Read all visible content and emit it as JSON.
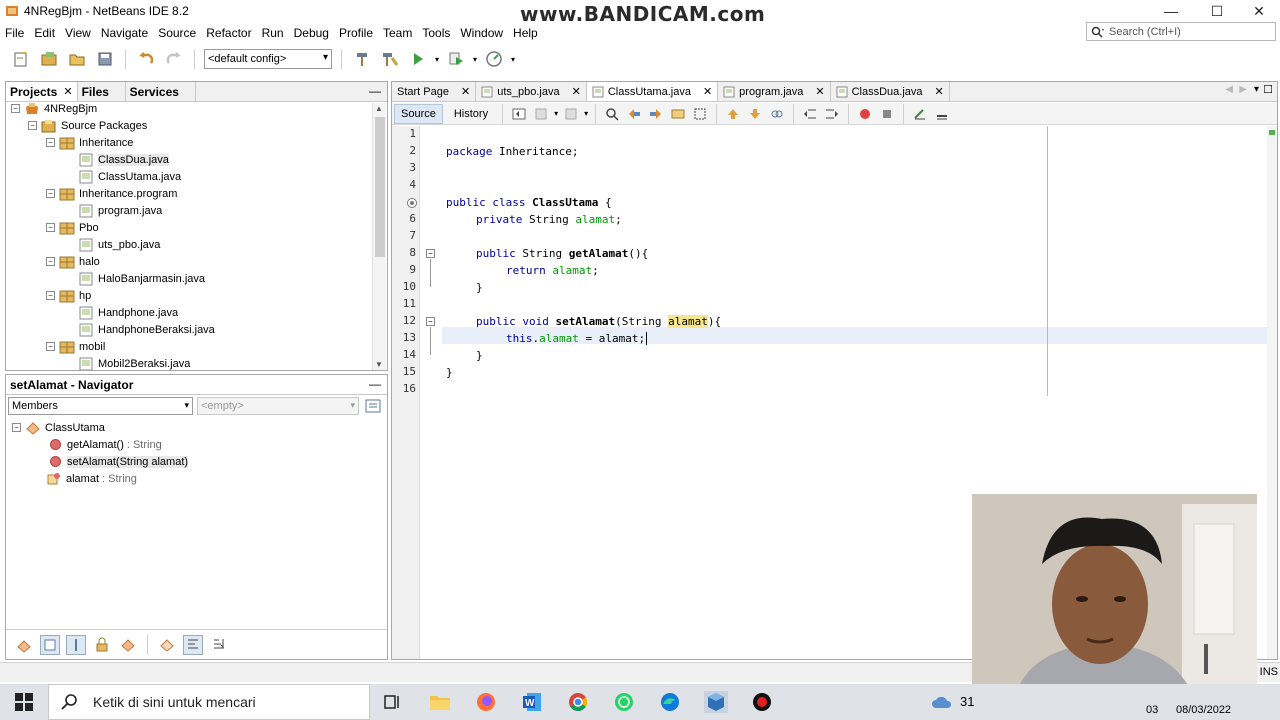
{
  "window": {
    "title": "4NRegBjm - NetBeans IDE 8.2",
    "watermark": "www.BANDICAM.com",
    "minimize": "—",
    "maximize": "☐",
    "close": "✕"
  },
  "menubar": [
    "File",
    "Edit",
    "View",
    "Navigate",
    "Source",
    "Refactor",
    "Run",
    "Debug",
    "Profile",
    "Team",
    "Tools",
    "Window",
    "Help"
  ],
  "search": {
    "placeholder": "Search (Ctrl+I)"
  },
  "toolbar": {
    "config": "<default config>"
  },
  "projects_panel": {
    "tabs": [
      {
        "label": "Projects",
        "close": "✕"
      },
      {
        "label": "Files"
      },
      {
        "label": "Services"
      }
    ],
    "minimize": "—",
    "tree": [
      {
        "label": "4NRegBjm",
        "toggle": "−",
        "icon": "project-icon"
      },
      {
        "label": "Source Packages",
        "toggle": "−",
        "icon": "source-packages-icon"
      },
      {
        "label": "Inheritance",
        "toggle": "−",
        "icon": "package-icon"
      },
      {
        "label": "ClassDua.java",
        "icon": "java-file-icon",
        "selected": true
      },
      {
        "label": "ClassUtama.java",
        "icon": "java-file-icon"
      },
      {
        "label": "Inheritance.program",
        "toggle": "−",
        "icon": "package-icon"
      },
      {
        "label": "program.java",
        "icon": "java-file-icon"
      },
      {
        "label": "Pbo",
        "toggle": "−",
        "icon": "package-icon"
      },
      {
        "label": "uts_pbo.java",
        "icon": "java-file-icon"
      },
      {
        "label": "halo",
        "toggle": "−",
        "icon": "package-icon"
      },
      {
        "label": "HaloBanjarmasin.java",
        "icon": "java-file-icon"
      },
      {
        "label": "hp",
        "toggle": "−",
        "icon": "package-icon"
      },
      {
        "label": "Handphone.java",
        "icon": "java-file-icon"
      },
      {
        "label": "HandphoneBeraksi.java",
        "icon": "java-file-icon"
      },
      {
        "label": "mobil",
        "toggle": "−",
        "icon": "package-icon"
      },
      {
        "label": "Mobil2Beraksi.java",
        "icon": "java-file-icon"
      }
    ]
  },
  "navigator": {
    "title": "setAlamat - Navigator",
    "minimize": "—",
    "filter_members": "Members",
    "filter_empty": "<empty>",
    "class_name": "ClassUtama",
    "members": [
      {
        "name": "getAlamat()",
        "type": ": String"
      },
      {
        "name": "setAlamat(String alamat)",
        "type": ""
      },
      {
        "name": "alamat",
        "type": ": String"
      }
    ]
  },
  "editor": {
    "tabs": [
      {
        "label": "Start Page",
        "close": "✕"
      },
      {
        "label": "uts_pbo.java",
        "close": "✕"
      },
      {
        "label": "ClassUtama.java",
        "close": "✕",
        "active": true
      },
      {
        "label": "program.java",
        "close": "✕"
      },
      {
        "label": "ClassDua.java",
        "close": "✕"
      }
    ],
    "source_label": "Source",
    "history_label": "History",
    "line_numbers": [
      "1",
      "2",
      "3",
      "4",
      "5",
      "6",
      "7",
      "8",
      "9",
      "10",
      "11",
      "12",
      "13",
      "14",
      "15",
      "16"
    ],
    "current_line": 13,
    "code": {
      "l2_kw": "package",
      "l2_rest": " Inheritance;",
      "l5_kw": "public class",
      "l5_name": "ClassUtama",
      "l5_rest": " {",
      "l6_kw": "private",
      "l6_type": " String ",
      "l6_field": "alamat",
      "l6_end": ";",
      "l8_kw": "public",
      "l8_type": " String ",
      "l8_name": "getAlamat",
      "l8_rest": "(){",
      "l9_kw": "return",
      "l9_sp": " ",
      "l9_field": "alamat",
      "l9_end": ";",
      "l10": "}",
      "l12_kw": "public void",
      "l12_sp": " ",
      "l12_name": "setAlamat",
      "l12_mid": "(String ",
      "l12_param": "alamat",
      "l12_end": "){",
      "l13_kw": "this",
      "l13_dot": ".",
      "l13_field": "alamat",
      "l13_rest": " = alamat;",
      "l14": "}",
      "l15": "}"
    }
  },
  "status": {
    "ins": "INS"
  },
  "taskbar": {
    "search_text": "Ketik di sini untuk mencari",
    "clock_partial": "31",
    "date_partial": "08/03/2022",
    "time_partial": "03"
  }
}
